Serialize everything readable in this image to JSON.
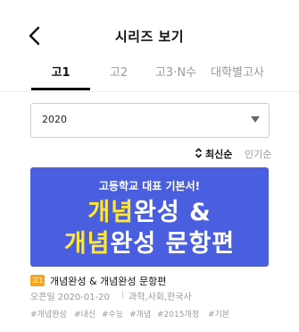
{
  "header": {
    "title": "시리즈 보기",
    "back_icon": "chevron-left-icon"
  },
  "tabs": [
    {
      "label": "고1",
      "active": true
    },
    {
      "label": "고2",
      "active": false
    },
    {
      "label": "고3·N수",
      "active": false
    },
    {
      "label": "대학별고사",
      "active": false
    }
  ],
  "year_select": {
    "value": "2020"
  },
  "sort": {
    "latest_label": "최신순",
    "popular_label": "인기순",
    "active": "latest"
  },
  "series": {
    "banner": {
      "subtitle": "고등학교 대표 기본서!",
      "line1_highlight": "개념",
      "line1_rest": "완성 &",
      "line2_highlight": "개념",
      "line2_rest": "완성 문항편",
      "colors": {
        "background": "#4a5fe0",
        "highlight": "#ffe633"
      }
    },
    "grade_badge": "고1",
    "title": "개념완성 & 개념완성 문항편",
    "date": "오픈일 2020-01-20",
    "subjects": "과학,사회,한국사",
    "tags": [
      "#개념완성",
      "#내신",
      "#수능",
      "#개념",
      "#2015개정",
      "#기본"
    ]
  }
}
